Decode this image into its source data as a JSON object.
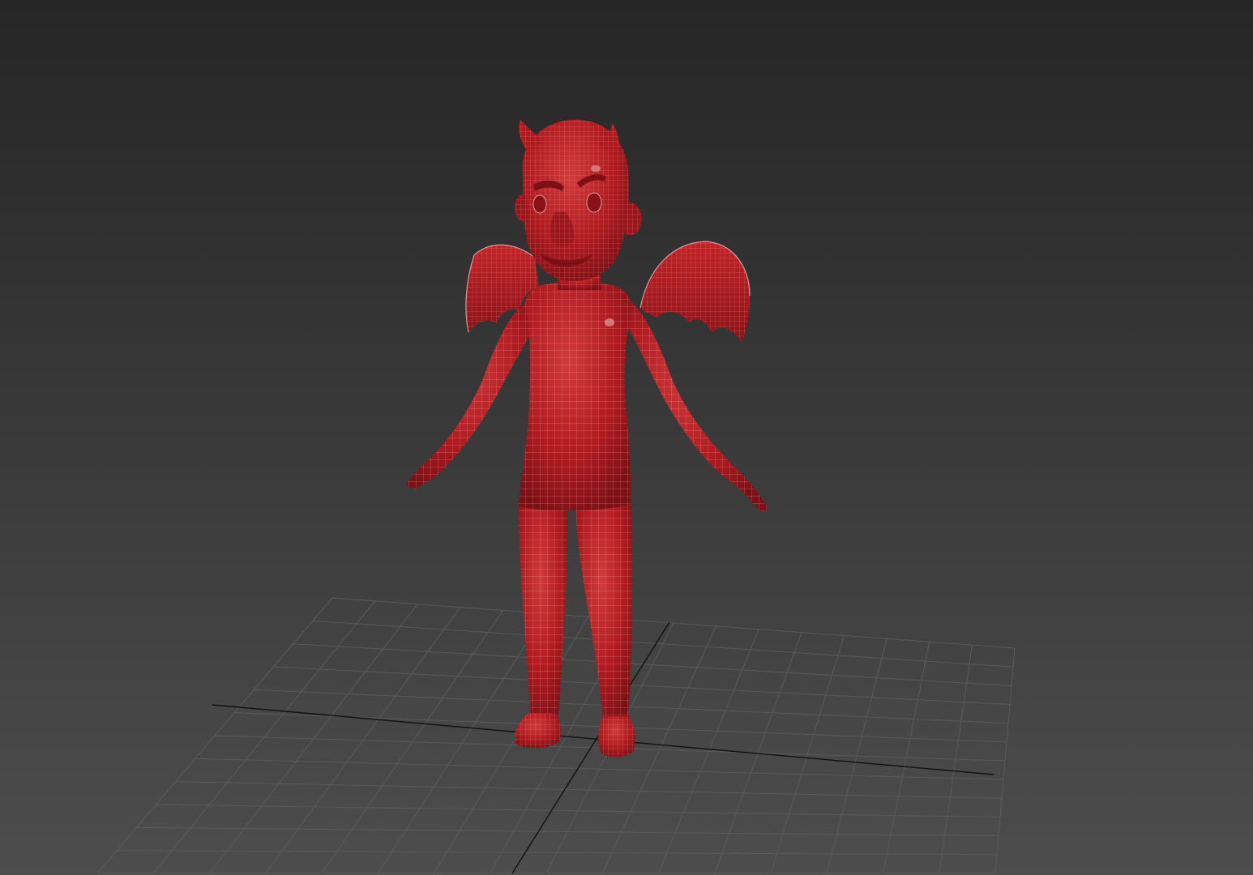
{
  "viewport": {
    "background_top": "#262626",
    "background_bottom": "#4d4d4d",
    "grid_color": "#5a5a5a",
    "axis_color": "#111111"
  },
  "model": {
    "body_color": "#b01a1f",
    "body_shadow": "#7d1015",
    "body_highlight": "#d23a3c",
    "wire_color": "#e4b9b9"
  }
}
